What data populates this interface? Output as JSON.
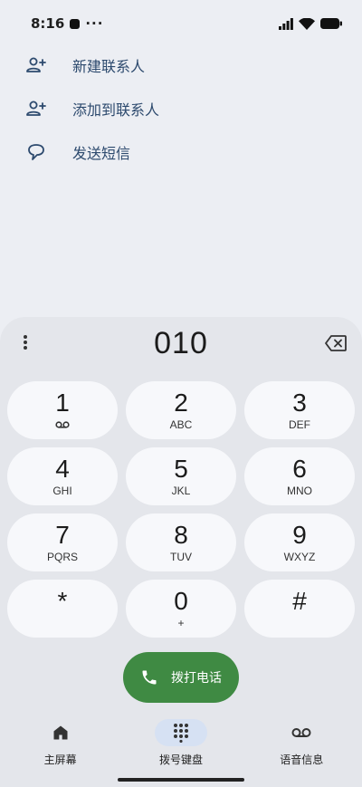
{
  "status_bar": {
    "time": "8:16",
    "more": "···"
  },
  "suggestions": [
    {
      "label": "新建联系人",
      "icon": "add-person-icon"
    },
    {
      "label": "添加到联系人",
      "icon": "add-person-icon"
    },
    {
      "label": "发送短信",
      "icon": "message-icon"
    }
  ],
  "dialer": {
    "number": "010",
    "keys": [
      {
        "digit": "1",
        "letters": ""
      },
      {
        "digit": "2",
        "letters": "ABC"
      },
      {
        "digit": "3",
        "letters": "DEF"
      },
      {
        "digit": "4",
        "letters": "GHI"
      },
      {
        "digit": "5",
        "letters": "JKL"
      },
      {
        "digit": "6",
        "letters": "MNO"
      },
      {
        "digit": "7",
        "letters": "PQRS"
      },
      {
        "digit": "8",
        "letters": "TUV"
      },
      {
        "digit": "9",
        "letters": "WXYZ"
      },
      {
        "digit": "*",
        "letters": ""
      },
      {
        "digit": "0",
        "letters": "+"
      },
      {
        "digit": "#",
        "letters": ""
      }
    ],
    "call_label": "拨打电话"
  },
  "bottom_nav": [
    {
      "label": "主屏幕",
      "icon": "home-icon",
      "active": false
    },
    {
      "label": "拨号键盘",
      "icon": "dialpad-icon",
      "active": true
    },
    {
      "label": "语音信息",
      "icon": "voicemail-icon",
      "active": false
    }
  ],
  "colors": {
    "accent": "#3f8a43",
    "link": "#2d4a6e",
    "nav_active": "#d6e1f3"
  }
}
